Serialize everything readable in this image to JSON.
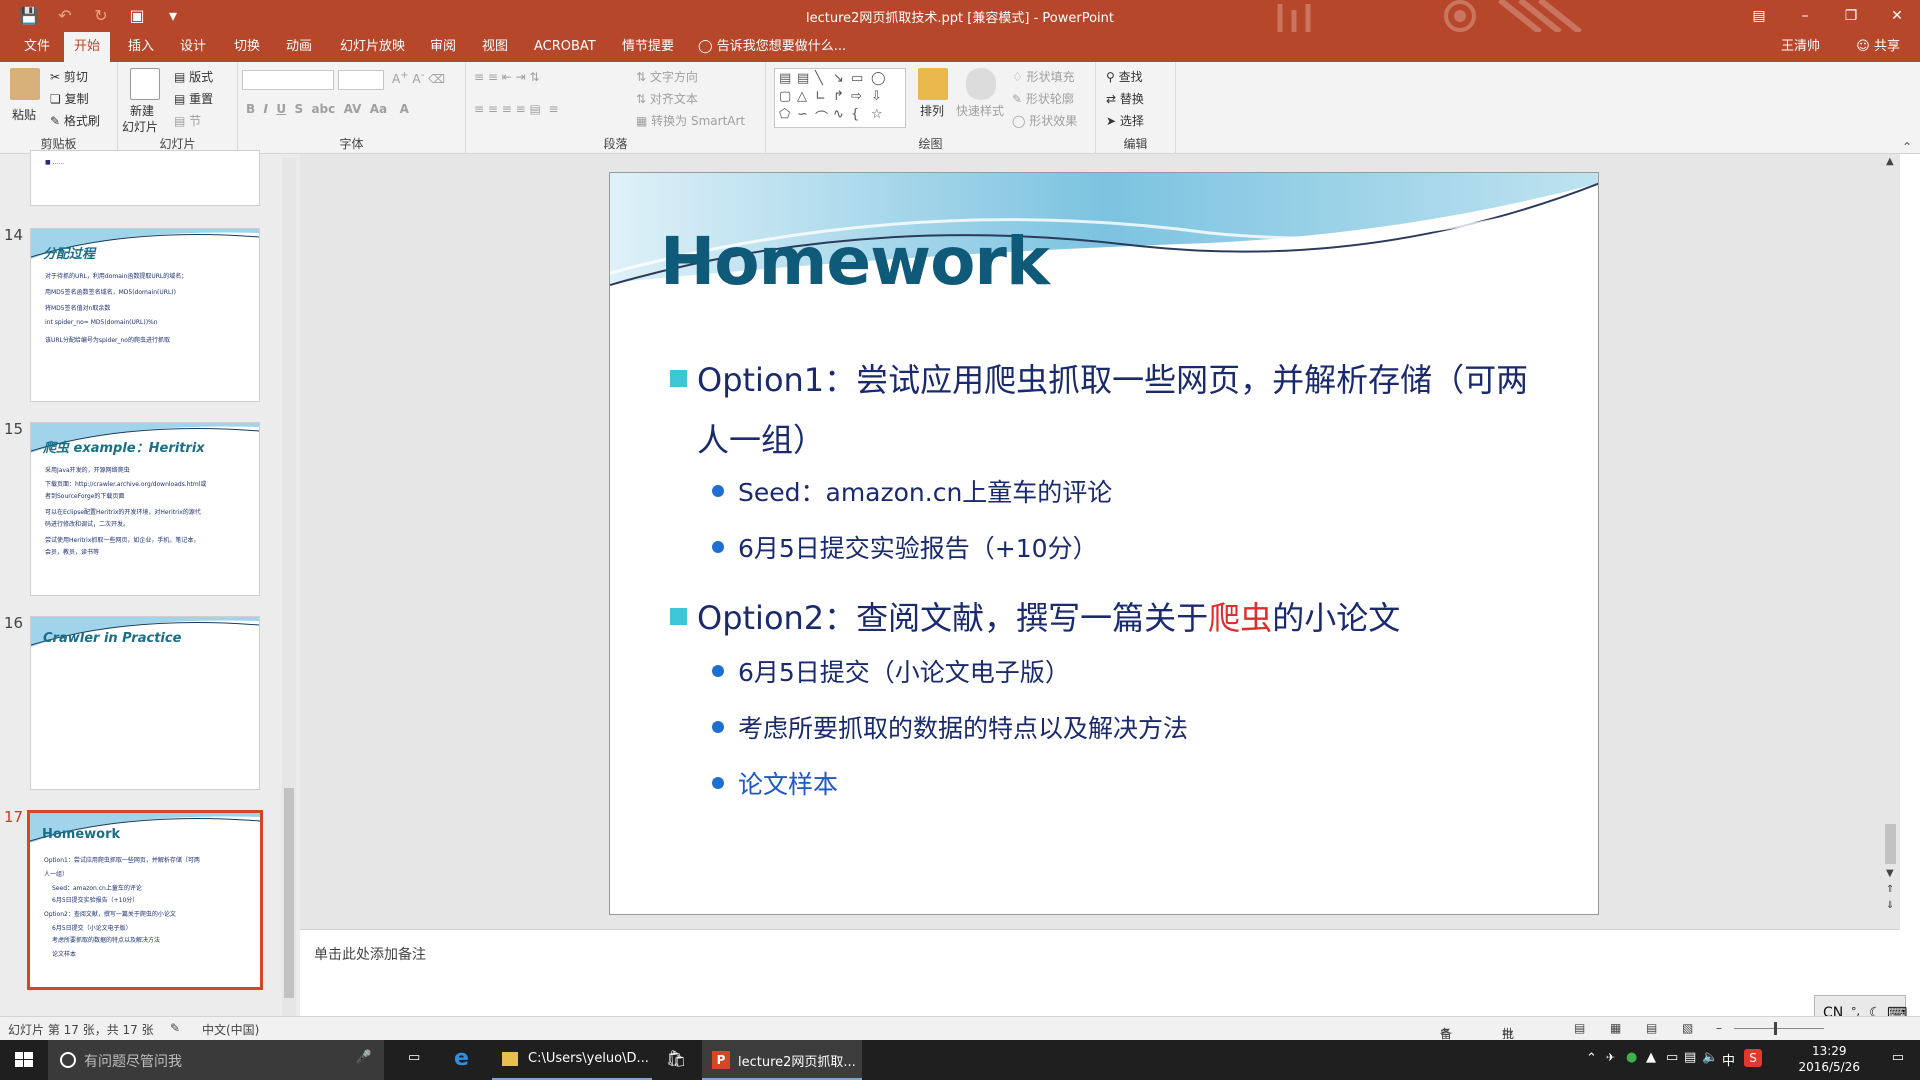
{
  "window": {
    "title": "lecture2网页抓取技术.ppt [兼容模式] - PowerPoint"
  },
  "tabs": [
    "文件",
    "开始",
    "插入",
    "设计",
    "切换",
    "动画",
    "幻灯片放映",
    "审阅",
    "视图",
    "ACROBAT",
    "情节提要"
  ],
  "tell_me": "告诉我您想要做什么...",
  "user": {
    "name": "王清帅",
    "share": "共享"
  },
  "ribbon": {
    "clipboard": {
      "paste": "粘贴",
      "cut": "剪切",
      "copy": "复制",
      "format_painter": "格式刷",
      "label": "剪贴板"
    },
    "slides": {
      "new_slide": "新建",
      "new_slide2": "幻灯片",
      "layout": "版式",
      "reset": "重置",
      "section": "节",
      "label": "幻灯片"
    },
    "font": {
      "label": "字体"
    },
    "paragraph": {
      "text_direction": "文字方向",
      "align_text": "对齐文本",
      "smartart": "转换为 SmartArt",
      "label": "段落"
    },
    "drawing": {
      "arrange": "排列",
      "quick_styles": "快速样式",
      "shape_fill": "形状填充",
      "shape_outline": "形状轮廓",
      "shape_effects": "形状效果",
      "label": "绘图"
    },
    "editing": {
      "find": "查找",
      "replace": "替换",
      "select": "选择",
      "label": "编辑"
    }
  },
  "thumbnails": [
    {
      "num": "14",
      "title": "分配过程",
      "lines": [
        "对于待抓的URL，利用domain函数提取URL的域名；",
        "用MD5签名函数签名域名，MD5(domain(URL))",
        "将MD5签名值对n取余数",
        "int spider_no= MD5(domain(URL))%n",
        "该URL分配给编号为spider_no的爬虫进行抓取"
      ]
    },
    {
      "num": "15",
      "title": "爬虫 example：Heritrix",
      "lines": [
        "采用Java开发的，开源网络爬虫",
        "下载页面：http://crawler.archive.org/downloads.html或",
        "者到SourceForge的下载页面",
        "可以在Eclipse配置Heritrix的开发环境，对Heritrix的源代",
        "码进行修改和调试，二次开发。",
        "尝试使用Heritrix抓取一些网页，如企业，手机，笔记本，",
        "会员，教员，读书等"
      ]
    },
    {
      "num": "16",
      "title": "Crawler in Practice",
      "lines": []
    },
    {
      "num": "17",
      "title": "Homework",
      "lines": [
        "Option1：尝试应用爬虫抓取一些网页，并解析存储（可两",
        "人一组）",
        "Seed：amazon.cn上童车的评论",
        "6月5日提交实验报告（+10分）",
        "Option2：查阅文献，撰写一篇关于爬虫的小论文",
        "6月5日提交（小论文电子版）",
        "考虑所要抓取的数据的特点以及解决方法",
        "论文样本"
      ]
    }
  ],
  "slide": {
    "title": "Homework",
    "option1_a": "Option1：尝试应用爬虫抓取一些网页，并解析存储（可两",
    "option1_b": "人一组）",
    "seed": "Seed：amazon.cn上童车的评论",
    "deadline1": "6月5日提交实验报告（+10分）",
    "option2_pre": "Option2：查阅文献，撰写一篇关于",
    "option2_red": "爬虫",
    "option2_post": "的小论文",
    "deadline2": "6月5日提交（小论文电子版）",
    "consider": "考虑所要抓取的数据的特点以及解决方法",
    "sample": "论文样本"
  },
  "notes_placeholder": "单击此处添加备注",
  "status": {
    "slide_count": "幻灯片 第 17 张，共 17 张",
    "language": "中文(中国)",
    "notes": "备注",
    "comments": "批注"
  },
  "ime": {
    "lang": "CN"
  },
  "taskbar": {
    "search_placeholder": "有问题尽管问我",
    "explorer_label": "C:\\Users\\yeluo\\D...",
    "ppt_label": "lecture2网页抓取...",
    "ime_char": "中",
    "time": "13:29",
    "date": "2016/5/26"
  },
  "colors": {
    "accent": "#b7472a",
    "slide_title": "#0f5a78",
    "bullet_text": "#1a2a6e",
    "highlight": "#e22b2b",
    "link": "#2057c8"
  }
}
